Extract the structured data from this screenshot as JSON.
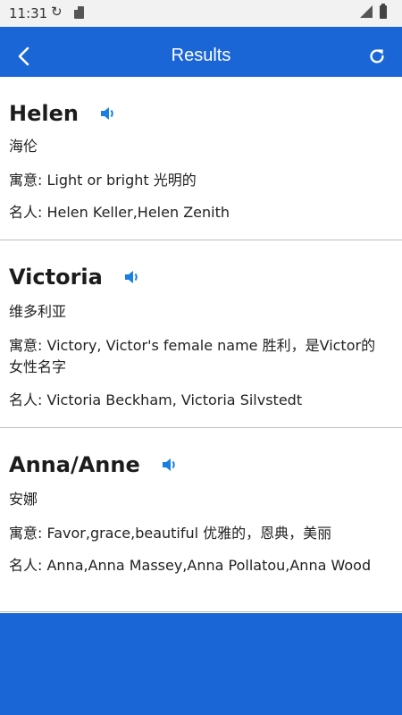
{
  "status_bar": {
    "time": "11:31"
  },
  "app_bar": {
    "title": "Results"
  },
  "results": [
    {
      "name": "Helen",
      "chinese": "海伦",
      "meaning": "寓意: Light or bright  光明的",
      "famous": "名人: Helen Keller,Helen Zenith"
    },
    {
      "name": "Victoria",
      "chinese": "维多利亚",
      "meaning": "寓意: Victory, Victor's female name  胜利，是Victor的女性名字",
      "famous": "名人: Victoria Beckham, Victoria Silvstedt"
    },
    {
      "name": "Anna/Anne",
      "chinese": "安娜",
      "meaning": "寓意: Favor,grace,beautiful  优雅的，恩典，美丽",
      "famous": "名人: Anna,Anna Massey,Anna Pollatou,Anna Wood"
    }
  ],
  "colors": {
    "primary": "#1a66d6",
    "speaker": "#1a7fe0"
  }
}
